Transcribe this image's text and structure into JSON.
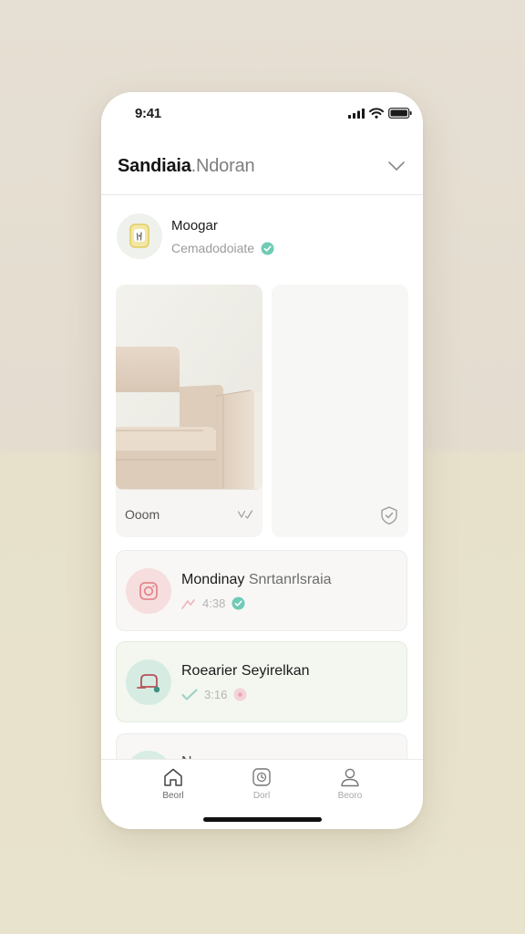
{
  "status_bar": {
    "time": "9:41"
  },
  "header": {
    "title_bold": "Sandiaia",
    "title_soft": ".Ndoran",
    "chevron_icon": "chevron-down-icon"
  },
  "profile": {
    "name": "Moogar",
    "subtitle": "Cemadodoiate",
    "verified_color": "#6fcbb6"
  },
  "featured": {
    "left_label": "Ooom",
    "left_icon": "check-mark-icon",
    "right_icon": "shield-check-icon"
  },
  "list": [
    {
      "title_a": "Mondinay",
      "title_b": "Snrtanrlsraia",
      "meta": "4:38",
      "avatar_color": "#f6dede",
      "status_color": "#6fcbb6"
    },
    {
      "title_a": "Roearier",
      "title_b": "Seyirelkan",
      "meta": "3:16",
      "avatar_color": "#d6ece3",
      "status_color": "#f2c6cd"
    },
    {
      "title_a": "N.",
      "title_b": ""
    }
  ],
  "tabs": [
    {
      "label": "Beorl",
      "icon": "home-icon"
    },
    {
      "label": "Dorl",
      "icon": "clock-icon"
    },
    {
      "label": "Beoro",
      "icon": "user-icon"
    }
  ],
  "colors": {
    "accent_green": "#6fcbb6",
    "accent_pink": "#f2c6cd",
    "background": "#e4ddd0"
  }
}
